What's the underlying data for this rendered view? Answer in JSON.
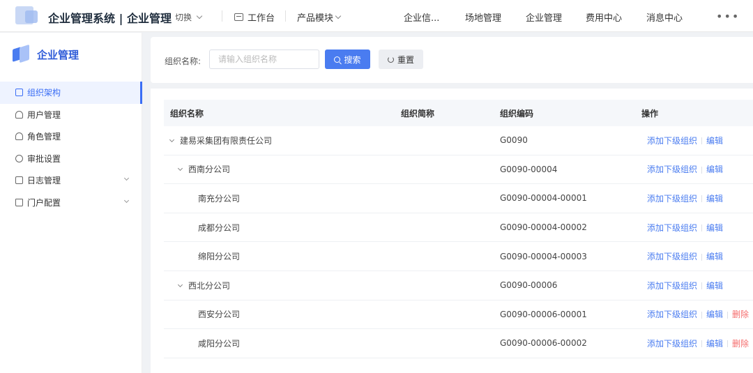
{
  "header": {
    "title": "企业管理系统 | 企业管理",
    "switch_label": "切换",
    "workbench_label": "工作台",
    "product_label": "产品模块",
    "nav": [
      "企业信...",
      "场地管理",
      "企业管理",
      "费用中心",
      "消息中心"
    ],
    "more": "•••"
  },
  "sidebar": {
    "brand": "企业管理",
    "items": [
      {
        "label": "组织架构",
        "icon": "org-icon",
        "active": true
      },
      {
        "label": "用户管理",
        "icon": "user-icon"
      },
      {
        "label": "角色管理",
        "icon": "role-icon"
      },
      {
        "label": "审批设置",
        "icon": "gear-icon"
      },
      {
        "label": "日志管理",
        "icon": "log-icon",
        "expandable": true
      },
      {
        "label": "门户配置",
        "icon": "home-icon",
        "expandable": true
      }
    ]
  },
  "search": {
    "label": "组织名称:",
    "placeholder": "请输入组织名称",
    "search_button": "搜索",
    "reset_button": "重置"
  },
  "table": {
    "columns": [
      "组织名称",
      "组织简称",
      "组织编码",
      "操作"
    ],
    "rows": [
      {
        "name": "建易采集团有限责任公司",
        "short": "",
        "code": "G0090",
        "level": 0,
        "expanded": true,
        "deletable": false
      },
      {
        "name": "西南分公司",
        "short": "",
        "code": "G0090-00004",
        "level": 1,
        "expanded": true,
        "deletable": false
      },
      {
        "name": "南充分公司",
        "short": "",
        "code": "G0090-00004-00001",
        "level": 2,
        "deletable": false
      },
      {
        "name": "成都分公司",
        "short": "",
        "code": "G0090-00004-00002",
        "level": 2,
        "deletable": false
      },
      {
        "name": "绵阳分公司",
        "short": "",
        "code": "G0090-00004-00003",
        "level": 2,
        "deletable": false
      },
      {
        "name": "西北分公司",
        "short": "",
        "code": "G0090-00006",
        "level": 1,
        "expanded": true,
        "deletable": false
      },
      {
        "name": "西安分公司",
        "short": "",
        "code": "G0090-00006-00001",
        "level": 2,
        "deletable": true
      },
      {
        "name": "咸阳分公司",
        "short": "",
        "code": "G0090-00006-00002",
        "level": 2,
        "deletable": true
      }
    ],
    "actions": {
      "add_child": "添加下级组织",
      "edit": "编辑",
      "delete": "删除"
    }
  },
  "colors": {
    "primary": "#4a7cf0",
    "danger": "#f56c6c",
    "brand": "#2e5bd8"
  }
}
